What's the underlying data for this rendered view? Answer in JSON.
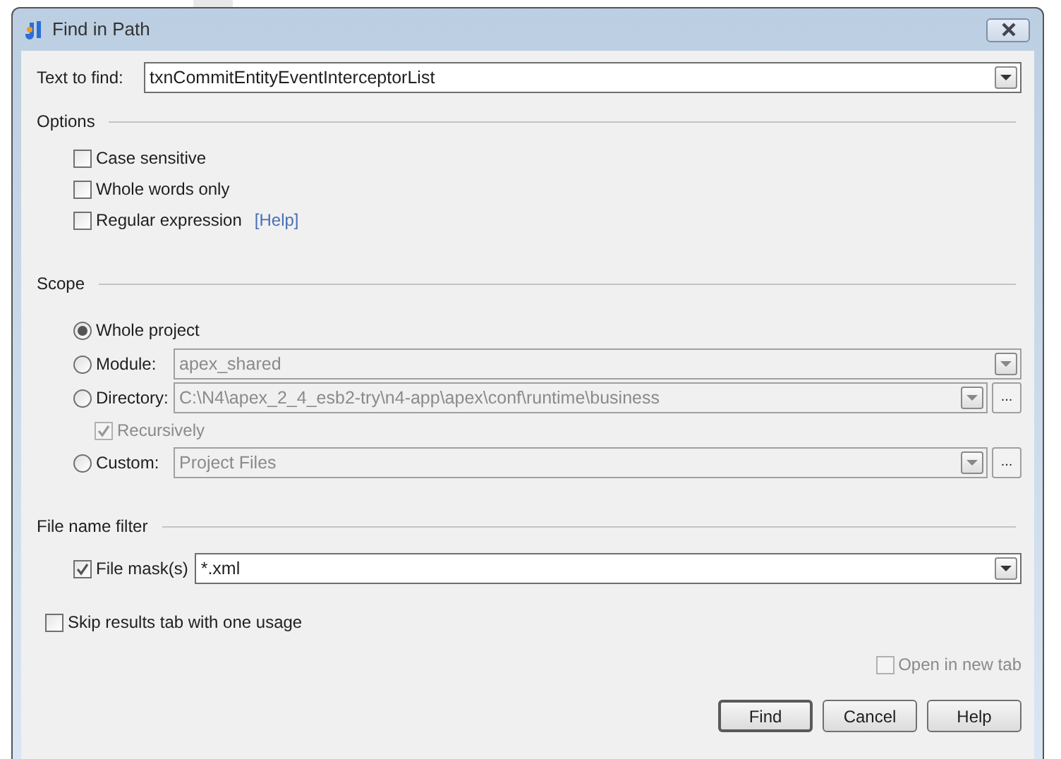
{
  "window": {
    "title": "Find in Path"
  },
  "text_to_find": {
    "label": "Text to find:",
    "value": "txnCommitEntityEventInterceptorList"
  },
  "options": {
    "heading": "Options",
    "checkboxes": [
      {
        "label": "Case sensitive",
        "checked": false
      },
      {
        "label": "Whole words only",
        "checked": false
      },
      {
        "label": "Regular expression",
        "checked": false,
        "link": "[Help]"
      }
    ]
  },
  "scope": {
    "heading": "Scope",
    "choices": [
      {
        "kind": "plain",
        "label": "Whole project",
        "selected": true
      },
      {
        "kind": "combo",
        "label": "Module:",
        "selected": false,
        "value": "apex_shared",
        "disabled": true
      },
      {
        "kind": "combo_browse",
        "label": "Directory:",
        "selected": false,
        "value": "C:\\N4\\apex_2_4_esb2-try\\n4-app\\apex\\conf\\runtime\\business",
        "disabled": true,
        "browse_label": "...",
        "sub_option": {
          "label": "Recursively",
          "checked": true,
          "disabled": true
        }
      },
      {
        "kind": "combo_browse",
        "label": "Custom:",
        "selected": false,
        "value": "Project Files",
        "disabled": true,
        "browse_label": "..."
      }
    ]
  },
  "file_name_filter": {
    "heading": "File name filter",
    "file_mask": {
      "label": "File mask(s)",
      "checked": true,
      "value": "*.xml"
    }
  },
  "skip_results": {
    "label": "Skip results tab with one usage",
    "checked": false
  },
  "open_in_new_tab": {
    "label": "Open in new tab",
    "checked": false,
    "disabled": true
  },
  "buttons": [
    {
      "label": "Find",
      "default": true
    },
    {
      "label": "Cancel",
      "default": false
    },
    {
      "label": "Help",
      "default": false
    }
  ]
}
